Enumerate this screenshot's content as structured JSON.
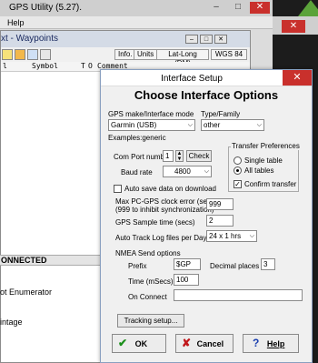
{
  "background": {
    "app_title": "GPS Utility (5.27).",
    "menu_help": "Help",
    "window_controls": {
      "minimize": "–",
      "maximize": "□",
      "close": "✕"
    },
    "small_close": "✕",
    "waypoint_window": {
      "title": "xt - Waypoints",
      "controls": [
        "–",
        "□",
        "✕"
      ],
      "toolbar": {
        "info": "Info.",
        "units": "Units",
        "latlong": "Lat-Long (DM)",
        "datum": "WGS 84"
      },
      "headers": [
        "l",
        "Symbol",
        "T",
        "O",
        "Comment"
      ],
      "status": "ONNECTED",
      "items": [
        "ot Enumerator",
        "intage"
      ]
    }
  },
  "dialog": {
    "title": "Interface Setup",
    "close": "✕",
    "heading": "Choose Interface Options",
    "make_label": "GPS make/Interface mode",
    "make_value": "Garmin (USB)",
    "type_label": "Type/Family",
    "type_value": "other",
    "examples": "Examples:generic",
    "com_port_label": "Com Port number",
    "com_port_value": "1",
    "check_button": "Check",
    "baud_label": "Baud rate",
    "baud_value": "4800",
    "transfer": {
      "legend": "Transfer Preferences",
      "single": "Single table",
      "all": "All tables",
      "confirm": "Confirm transfer"
    },
    "auto_save_label": "Auto save data on download",
    "clock_label_1": "Max PC-GPS clock error (secs)",
    "clock_label_2": "(999 to inhibit synchronization)",
    "clock_value": "999",
    "sample_label": "GPS Sample time (secs)",
    "sample_value": "2",
    "autotrack_label": "Auto Track Log files per Day",
    "autotrack_value": "24 x 1 hrs",
    "nmea_label": "NMEA  Send options",
    "prefix_label": "Prefix",
    "prefix_value": "$GP",
    "decimal_label": "Decimal places",
    "decimal_value": "3",
    "time_label": "Time (mSecs)",
    "time_value": "100",
    "onconnect_label": "On Connect",
    "onconnect_value": "",
    "tracking_button": "Tracking setup...",
    "ok": "OK",
    "cancel": "Cancel",
    "help": "Help"
  }
}
